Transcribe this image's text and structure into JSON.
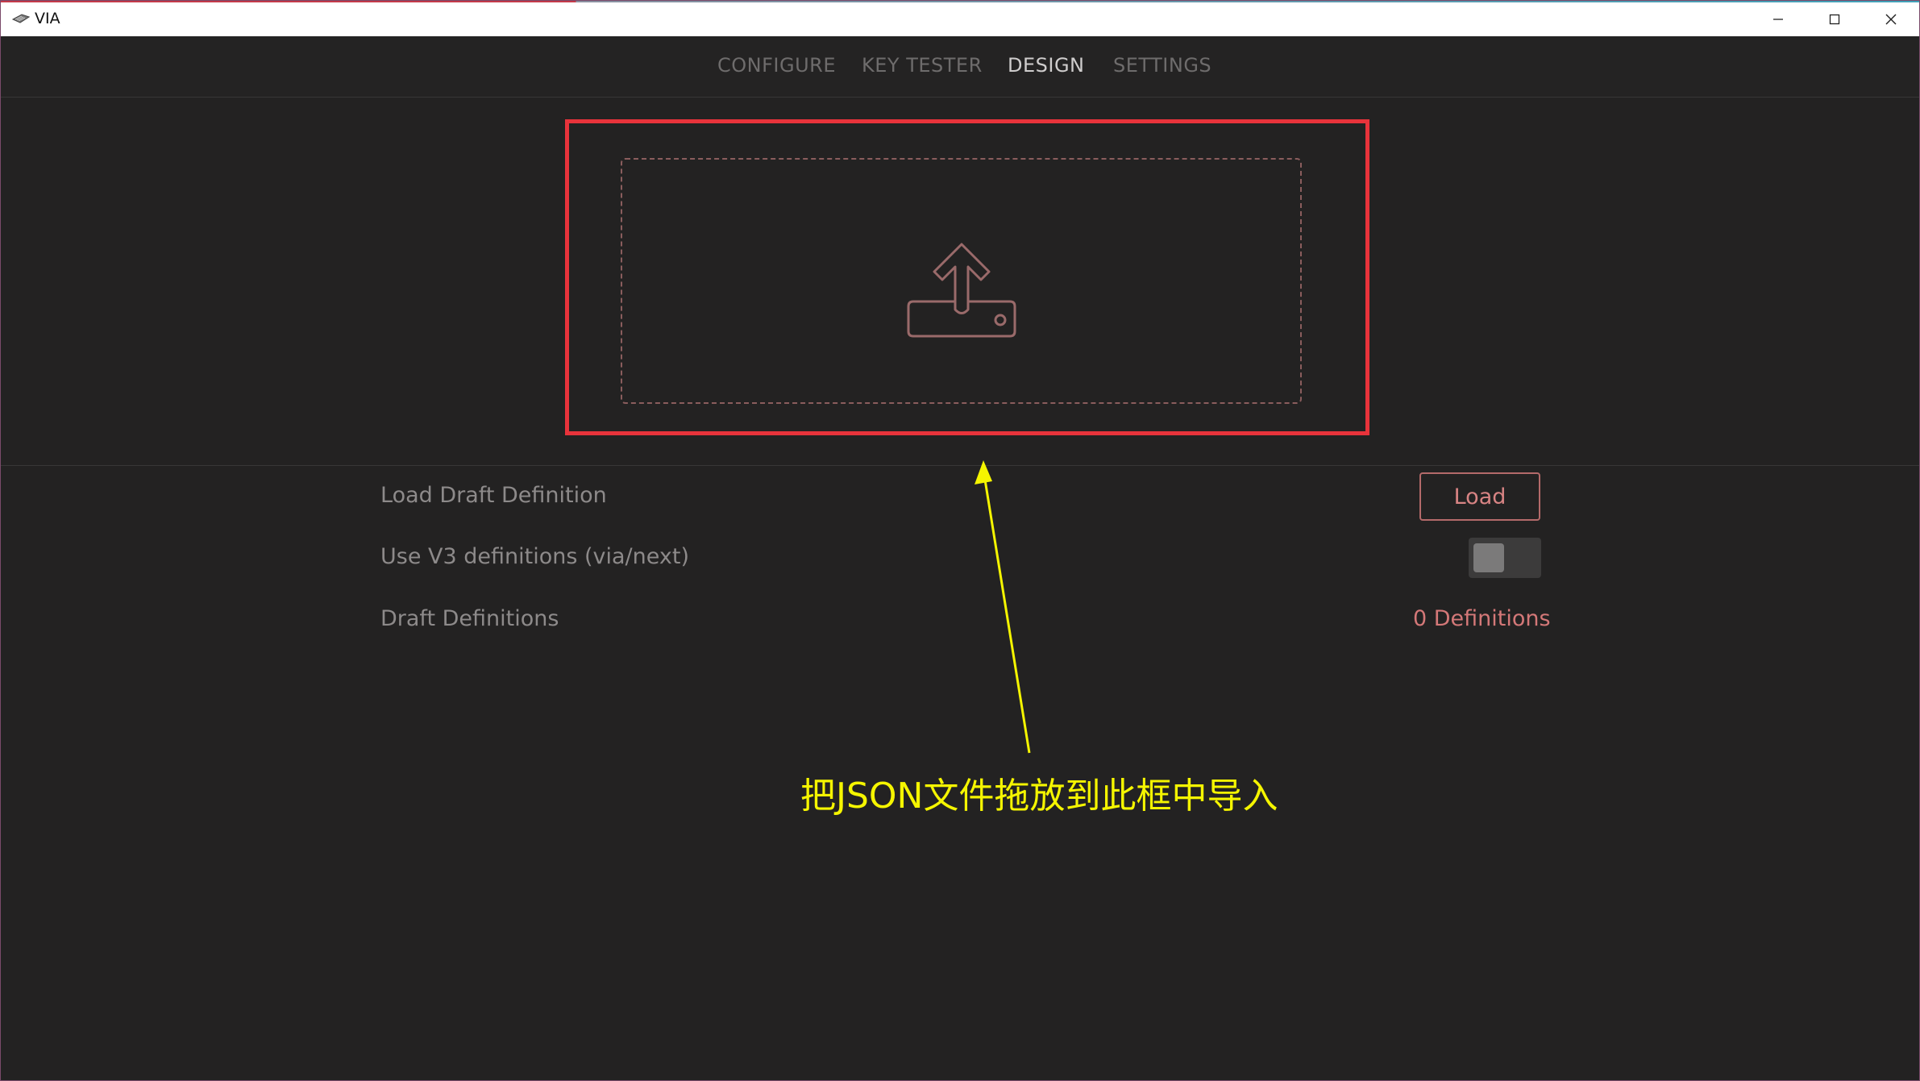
{
  "window": {
    "title": "VIA",
    "icon": "keyboard-icon"
  },
  "nav": {
    "tabs": [
      {
        "label": "CONFIGURE",
        "active": false
      },
      {
        "label": "KEY TESTER",
        "active": false
      },
      {
        "label": "DESIGN",
        "active": true
      },
      {
        "label": "SETTINGS",
        "active": false
      }
    ]
  },
  "upload": {
    "icon": "upload-icon"
  },
  "settings": {
    "load_label": "Load Draft Definition",
    "load_button": "Load",
    "v3_label": "Use V3 definitions (via/next)",
    "v3_enabled": false,
    "drafts_label": "Draft Definitions",
    "drafts_count": "0 Definitions"
  },
  "annotation": {
    "text": "把JSON文件拖放到此框中导入",
    "color": "#f5f500"
  },
  "colors": {
    "accent": "#d47878",
    "highlight": "#e8333b",
    "background": "#232222"
  }
}
